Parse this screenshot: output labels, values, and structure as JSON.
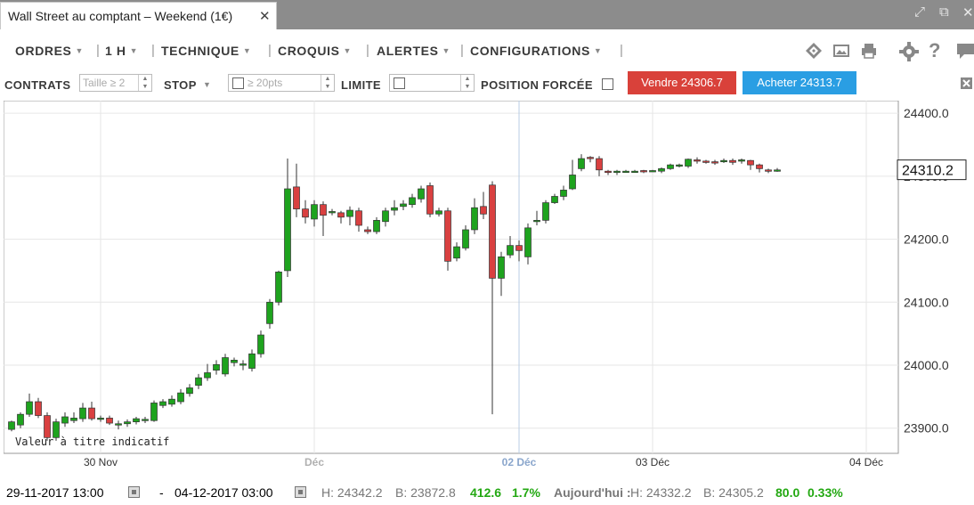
{
  "tab": {
    "title": "Wall Street au comptant – Weekend (1€)",
    "close": "✕"
  },
  "window_controls": {
    "expand": "⤢",
    "popout": "⧉",
    "close": "✕"
  },
  "menu": {
    "items": [
      "ORDRES",
      "1 H",
      "TECHNIQUE",
      "CROQUIS",
      "ALERTES",
      "CONFIGURATIONS"
    ]
  },
  "toolbar_icons": [
    "layers-icon",
    "image-icon",
    "print-icon",
    "gear-icon",
    "help-icon",
    "chat-icon"
  ],
  "order": {
    "contracts_label": "CONTRATS",
    "size_placeholder": "Taille ≥ 2",
    "stop_label": "STOP",
    "stop_placeholder": "≥ 20pts",
    "limit_label": "LIMITE",
    "forced_label": "POSITION FORCÉE",
    "sell_label": "Vendre 24306.7",
    "buy_label": "Acheter 24313.7"
  },
  "colors": {
    "up": "#1ea31e",
    "down": "#d94040",
    "sell": "#d9413a",
    "buy": "#2a9ee3",
    "cursor": "#b8cce4"
  },
  "chart_data": {
    "type": "candlestick",
    "yticks": [
      "24400.0",
      "24300.0",
      "24200.0",
      "24100.0",
      "24000.0",
      "23900.0"
    ],
    "ytick_values": [
      24400,
      24300,
      24200,
      24100,
      24000,
      23900
    ],
    "ylim": [
      23860,
      24420
    ],
    "current_price": "24310.2",
    "current_value": 24310.2,
    "xticks": [
      {
        "label": "30 Nov",
        "index": 10.5,
        "style": "normal"
      },
      {
        "label": "Déc",
        "index": 34.5,
        "style": "muted"
      },
      {
        "label": "02 Déc",
        "index": 57.5,
        "style": "active"
      },
      {
        "label": "03 Déc",
        "index": 72.5,
        "style": "normal"
      },
      {
        "label": "04 Déc",
        "index": 96.5,
        "style": "normal"
      }
    ],
    "crosshair_index": 57.5,
    "note": "Valeur à titre indicatif",
    "candles": [
      [
        23898,
        23910,
        23895,
        23912
      ],
      [
        23905,
        23922,
        23900,
        23925
      ],
      [
        23922,
        23942,
        23918,
        23955
      ],
      [
        23942,
        23920,
        23916,
        23948
      ],
      [
        23920,
        23885,
        23880,
        23925
      ],
      [
        23885,
        23910,
        23880,
        23915
      ],
      [
        23908,
        23918,
        23902,
        23925
      ],
      [
        23912,
        23916,
        23908,
        23925
      ],
      [
        23915,
        23932,
        23910,
        23940
      ],
      [
        23932,
        23915,
        23912,
        23942
      ],
      [
        23915,
        23916,
        23910,
        23920
      ],
      [
        23916,
        23908,
        23905,
        23920
      ],
      [
        23905,
        23907,
        23898,
        23912
      ],
      [
        23907,
        23910,
        23902,
        23914
      ],
      [
        23910,
        23915,
        23906,
        23918
      ],
      [
        23912,
        23914,
        23908,
        23918
      ],
      [
        23912,
        23940,
        23910,
        23944
      ],
      [
        23936,
        23942,
        23932,
        23946
      ],
      [
        23938,
        23946,
        23934,
        23952
      ],
      [
        23942,
        23956,
        23938,
        23962
      ],
      [
        23955,
        23964,
        23950,
        23970
      ],
      [
        23968,
        23980,
        23962,
        23986
      ],
      [
        23980,
        23988,
        23975,
        24002
      ],
      [
        23992,
        24001,
        23985,
        24008
      ],
      [
        23986,
        24012,
        23982,
        24018
      ],
      [
        24004,
        24008,
        23998,
        24012
      ],
      [
        24000,
        24002,
        23992,
        24008
      ],
      [
        23995,
        24018,
        23990,
        24025
      ],
      [
        24018,
        24048,
        24012,
        24055
      ],
      [
        24066,
        24100,
        24058,
        24105
      ],
      [
        24100,
        24148,
        24095,
        24150
      ],
      [
        24150,
        24280,
        24140,
        24328
      ],
      [
        24283,
        24248,
        24235,
        24320
      ],
      [
        24248,
        24235,
        24225,
        24262
      ],
      [
        24232,
        24255,
        24220,
        24262
      ],
      [
        24255,
        24238,
        24205,
        24260
      ],
      [
        24242,
        24244,
        24238,
        24248
      ],
      [
        24242,
        24235,
        24225,
        24245
      ],
      [
        24236,
        24246,
        24222,
        24252
      ],
      [
        24245,
        24222,
        24212,
        24250
      ],
      [
        24215,
        24212,
        24208,
        24220
      ],
      [
        24212,
        24230,
        24208,
        24235
      ],
      [
        24228,
        24245,
        24220,
        24250
      ],
      [
        24246,
        24250,
        24238,
        24262
      ],
      [
        24252,
        24256,
        24246,
        24262
      ],
      [
        24255,
        24266,
        24250,
        24272
      ],
      [
        24264,
        24280,
        24258,
        24285
      ],
      [
        24285,
        24240,
        24235,
        24290
      ],
      [
        24240,
        24245,
        24236,
        24250
      ],
      [
        24245,
        24165,
        24150,
        24250
      ],
      [
        24170,
        24188,
        24165,
        24195
      ],
      [
        24186,
        24215,
        24182,
        24222
      ],
      [
        24215,
        24250,
        24208,
        24265
      ],
      [
        24252,
        24240,
        24232,
        24275
      ],
      [
        24286,
        24138,
        23922,
        24292
      ],
      [
        24138,
        24172,
        24110,
        24180
      ],
      [
        24175,
        24190,
        24170,
        24205
      ],
      [
        24190,
        24182,
        24165,
        24198
      ],
      [
        24172,
        24218,
        24160,
        24225
      ],
      [
        24228,
        24230,
        24222,
        24245
      ],
      [
        24230,
        24258,
        24225,
        24262
      ],
      [
        24258,
        24268,
        24256,
        24272
      ],
      [
        24268,
        24278,
        24262,
        24285
      ],
      [
        24280,
        24302,
        24278,
        24326
      ],
      [
        24312,
        24328,
        24308,
        24335
      ],
      [
        24330,
        24328,
        24322,
        24332
      ],
      [
        24328,
        24310,
        24300,
        24332
      ],
      [
        24308,
        24306,
        24302,
        24310
      ],
      [
        24306,
        24308,
        24302,
        24310
      ],
      [
        24308,
        24308,
        24306,
        24310
      ],
      [
        24308,
        24308,
        24306,
        24310
      ],
      [
        24309,
        24308,
        24305,
        24310
      ],
      [
        24308,
        24309,
        24307,
        24310
      ],
      [
        24308,
        24312,
        24305,
        24314
      ],
      [
        24312,
        24318,
        24310,
        24320
      ],
      [
        24316,
        24318,
        24314,
        24320
      ],
      [
        24316,
        24327,
        24313,
        24328
      ],
      [
        24326,
        24324,
        24320,
        24330
      ],
      [
        24324,
        24323,
        24320,
        24326
      ],
      [
        24323,
        24322,
        24318,
        24326
      ],
      [
        24324,
        24325,
        24321,
        24328
      ],
      [
        24325,
        24322,
        24318,
        24328
      ],
      [
        24324,
        24326,
        24320,
        24328
      ],
      [
        24325,
        24318,
        24310,
        24326
      ],
      [
        24318,
        24312,
        24306,
        24320
      ],
      [
        24310,
        24308,
        24305,
        24312
      ],
      [
        24309,
        24310,
        24307,
        24313
      ]
    ]
  },
  "status": {
    "date_from": "29-11-2017 13:00",
    "dash": "-",
    "date_to": "04-12-2017 03:00",
    "range_high": "H: 24342.2",
    "range_low": "B: 23872.8",
    "range_change": "412.6",
    "range_pct": "1.7%",
    "today_label": "Aujourd'hui :",
    "today_high": "H: 24332.2",
    "today_low": "B: 24305.2",
    "today_change": "80.0",
    "today_pct": "0.33%"
  }
}
